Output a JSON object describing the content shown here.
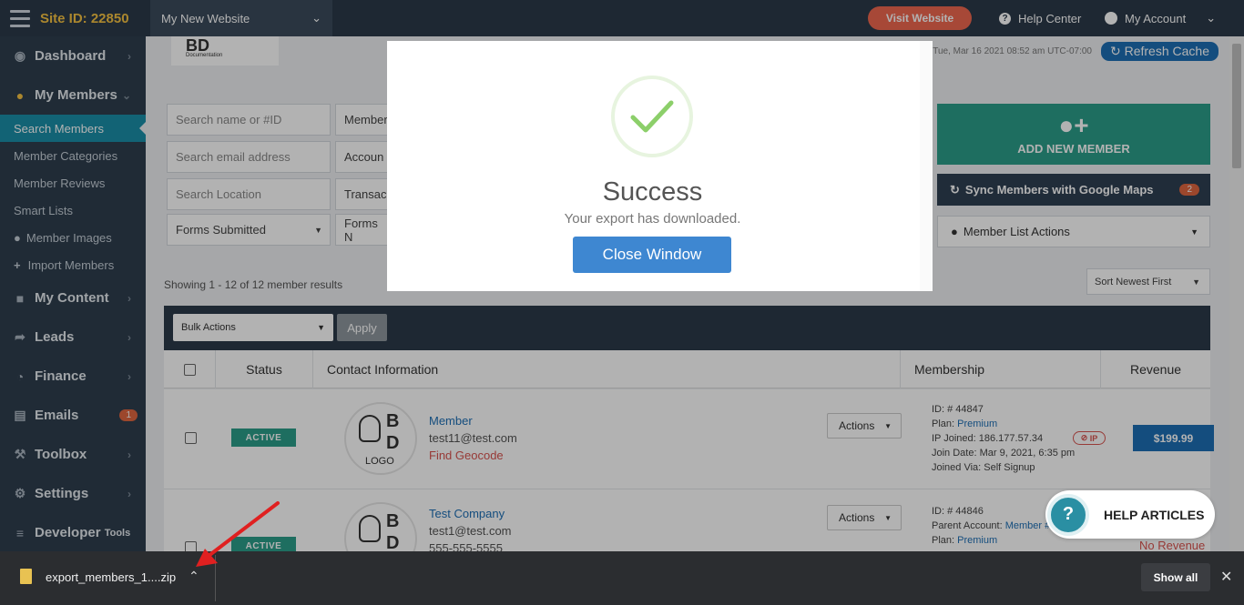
{
  "topbar": {
    "site_id": "Site ID: 22850",
    "site_select": "My New Website",
    "visit_website": "Visit Website",
    "help_center": "Help Center",
    "my_account": "My Account"
  },
  "sidebar": {
    "dashboard": "Dashboard",
    "my_members": "My Members",
    "search_members": "Search Members",
    "member_categories": "Member Categories",
    "member_reviews": "Member Reviews",
    "smart_lists": "Smart Lists",
    "member_images": "Member Images",
    "import_members": "Import Members",
    "my_content": "My Content",
    "leads": "Leads",
    "finance": "Finance",
    "emails": "Emails",
    "emails_badge": "1",
    "toolbox": "Toolbox",
    "settings": "Settings",
    "developer": "Developer",
    "developer_tools": "Tools"
  },
  "header": {
    "logo": "BD",
    "logo_sub": "Documentation",
    "cache_time": "e: Tue, Mar 16 2021 08:52 am UTC-07:00",
    "refresh_cache": "Refresh Cache"
  },
  "filters": {
    "search_name": "Search name or #ID",
    "member_col": "Member",
    "search_email": "Search email address",
    "account_col": "Accoun",
    "search_location": "Search Location",
    "transac_col": "Transac",
    "forms_submitted": "Forms Submitted",
    "forms_n": "Forms N"
  },
  "actions_panel": {
    "add_new_member": "ADD NEW MEMBER",
    "sync_maps": "Sync Members with Google Maps",
    "sync_count": "2",
    "member_list_actions": "Member List Actions"
  },
  "results": {
    "showing": "Showing 1 - 12 of 12 member results",
    "sort": "Sort Newest First",
    "bulk_actions": "Bulk Actions",
    "apply": "Apply"
  },
  "table": {
    "headers": {
      "status": "Status",
      "contact": "Contact Information",
      "membership": "Membership",
      "revenue": "Revenue"
    },
    "rows": [
      {
        "status": "ACTIVE",
        "name": "Member",
        "email": "test11@test.com",
        "geocode": "Find Geocode",
        "actions": "Actions",
        "id": "ID: # 44847",
        "plan_label": "Plan: ",
        "plan": "Premium",
        "ip": "IP Joined: 186.177.57.34",
        "ip_badge": "IP",
        "join_date": "Join Date: Mar 9, 2021, 6:35 pm",
        "joined_via": "Joined Via: Self Signup",
        "revenue": "$199.99"
      },
      {
        "status": "ACTIVE",
        "name": "Test Company",
        "email": "test1@test.com",
        "phone": "555-555-5555",
        "actions": "Actions",
        "id": "ID: # 44846",
        "parent_label": "Parent Account: ",
        "parent": "Member #1",
        "plan_label": "Plan: ",
        "plan": "Premium",
        "revenue": "No Revenue"
      }
    ],
    "avatar_text": "LOGO"
  },
  "help_articles": "HELP ARTICLES",
  "modal": {
    "title": "Success",
    "message": "Your export has downloaded.",
    "close": "Close Window"
  },
  "download_bar": {
    "filename": "export_members_1....zip",
    "show_all": "Show all"
  },
  "colors": {
    "topbar": "#2b3a4a",
    "sidebar": "#2f3e4e",
    "accent_teal": "#2b9e8a",
    "brand_blue": "#1e6fb5",
    "visit_orange": "#f0674f"
  }
}
